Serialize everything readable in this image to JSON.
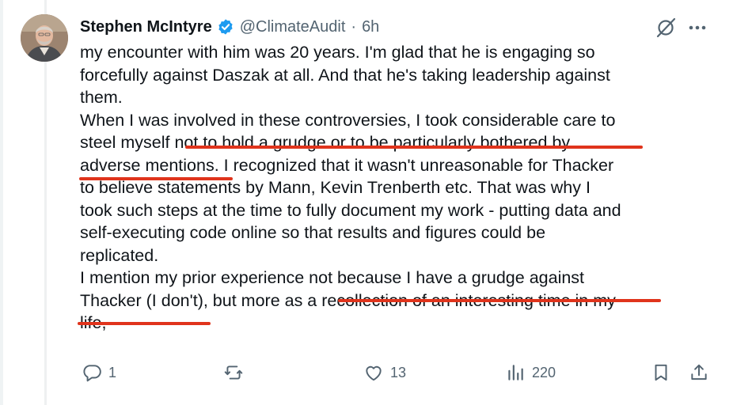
{
  "author": {
    "name": "Stephen McIntyre",
    "handle": "@ClimateAudit",
    "separator": "·",
    "time": "6h"
  },
  "tweet": {
    "lines": [
      "my encounter with him was 20 years.  I'm glad that he is engaging so",
      "forcefully against Daszak at all.  And that he's taking leadership against",
      "them.",
      "When I was involved in these controversies, I took considerable care to",
      "steel myself not to hold a grudge or to be particularly bothered by",
      "adverse mentions.  I recognized that it wasn't unreasonable for Thacker",
      "to believe statements by Mann, Kevin Trenberth etc.    That was why I",
      "took such steps at the time to fully document my work - putting data and",
      "self-executing code online so that results and figures could be",
      "replicated.",
      "I mention my prior experience not because I have a grudge against",
      "Thacker (I don't), but more as a recollection of an interesting time in my",
      "life,"
    ],
    "underlined_phrases": [
      "not to hold a grudge or to be particularly bothered by",
      "adverse mentions",
      "not because I have a grudge against",
      "Thacker (I don't)"
    ]
  },
  "actions": {
    "reply_count": "1",
    "repost_count": "",
    "like_count": "13",
    "views_count": "220"
  },
  "colors": {
    "text": "#0f1419",
    "secondary": "#536471",
    "verified": "#1d9bf0",
    "underline": "#e0341c"
  },
  "icons": [
    "verified-badge-icon",
    "grok-icon",
    "more-icon",
    "reply-icon",
    "repost-icon",
    "like-icon",
    "views-icon",
    "bookmark-icon",
    "share-icon"
  ]
}
